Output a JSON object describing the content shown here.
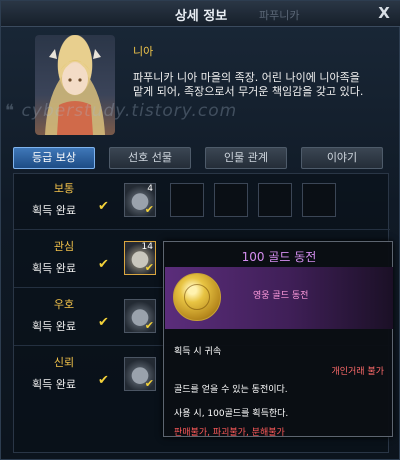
{
  "window": {
    "title": "상세 정보",
    "ghost_title": "파푸니카",
    "close_label": "X"
  },
  "npc": {
    "name": "니아",
    "description": "파푸니카 니아 마을의 족장. 어린 나이에 니아족을 맡게 되어, 족장으로서 무거운 책임감을 갖고 있다."
  },
  "watermark": "❝ cyberstudy.tistory.com",
  "tabs": [
    {
      "label": "등급 보상",
      "active": true
    },
    {
      "label": "선호 선물",
      "active": false
    },
    {
      "label": "인물 관계",
      "active": false
    },
    {
      "label": "이야기",
      "active": false
    }
  ],
  "reward_rows": [
    {
      "grade": "보통",
      "status": "획득 완료",
      "item_count": "4"
    },
    {
      "grade": "관심",
      "status": "획득 완료",
      "item_count": "14"
    },
    {
      "grade": "우호",
      "status": "획득 완료",
      "item_count": ""
    },
    {
      "grade": "신뢰",
      "status": "획득 완료",
      "item_count": ""
    }
  ],
  "check_glyph": "✔",
  "tooltip": {
    "title": "100 골드 동전",
    "item_name": "영웅 골드 동전",
    "bind": "획득 시 귀속",
    "trade": "개인거래 불가",
    "description": "골드를 얻을 수 있는 동전이다.",
    "use": "사용 시, 100골드를 획득한다.",
    "restrictions": "판매불가, 파괴불가, 분해불가"
  },
  "colors": {
    "grade_text": "#f0c04a",
    "active_tab": "#2a62a3",
    "tooltip_title": "#d58ef0",
    "hero_grade": "#5b2d7b",
    "warning": "#ff5a5a"
  }
}
